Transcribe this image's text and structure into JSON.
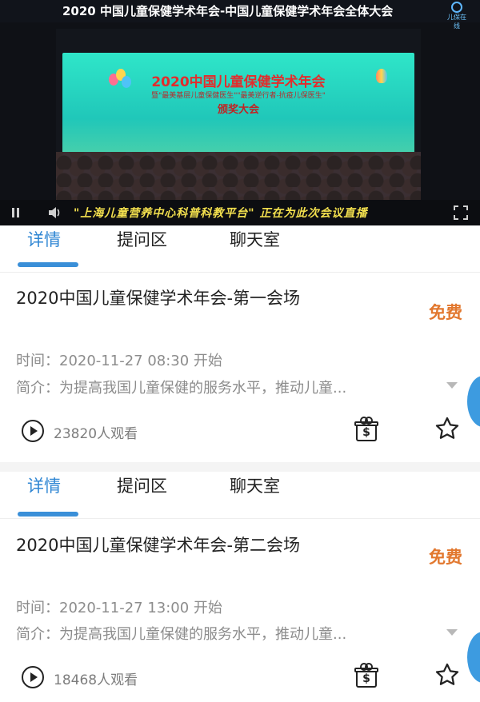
{
  "player": {
    "title": "2020 中国儿童保健学术年会-中国儿童保健学术年会全体大会",
    "corner_logo_text": "儿保在线",
    "banner": {
      "line1": "2020中国儿童保健学术年会",
      "line2": "暨\"最美基层儿童保健医生\"\"最美逆行者-抗疫儿保医生\"",
      "line3": "颁奖大会"
    },
    "ticker": "\"上海儿童营养中心科普科教平台\" 正在为此次会议直播",
    "icons": {
      "pause": "pause-icon",
      "volume": "volume-icon",
      "fullscreen": "fullscreen-icon"
    }
  },
  "tabs": [
    "详情",
    "提问区",
    "聊天室"
  ],
  "sessions": [
    {
      "title": "2020中国儿童保健学术年会-第一会场",
      "price": "免费",
      "time_label": "时间：",
      "time": "2020-11-27 08:30 开始",
      "intro_label": "简介：",
      "intro": "为提高我国儿童保健的服务水平，推动儿童...",
      "views": "23820人观看"
    },
    {
      "title": "2020中国儿童保健学术年会-第二会场",
      "price": "免费",
      "time_label": "时间：",
      "time": "2020-11-27 13:00 开始",
      "intro_label": "简介：",
      "intro": "为提高我国儿童保健的服务水平，推动儿童...",
      "views": "18468人观看"
    }
  ],
  "colors": {
    "accent": "#2f86d3",
    "price": "#e2782f",
    "muted": "#8c8c8c",
    "ticker": "#f3e04e"
  }
}
